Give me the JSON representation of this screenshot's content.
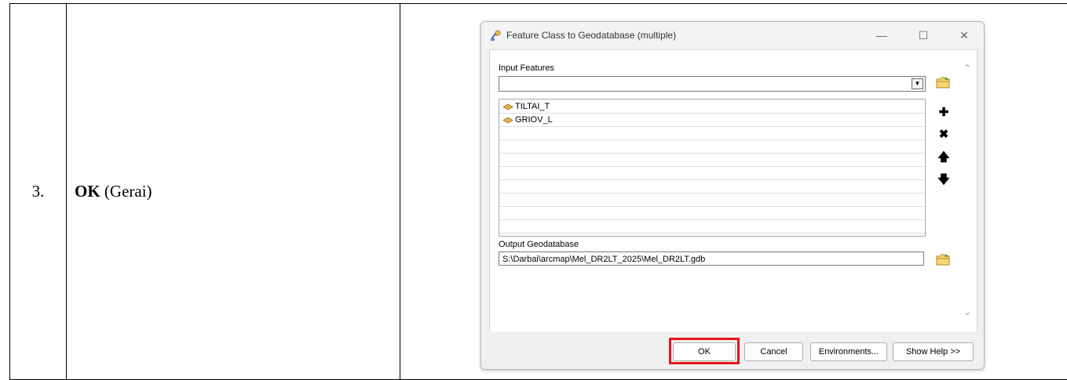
{
  "row": {
    "number": "3.",
    "instruction_bold": "OK",
    "instruction_rest": " (Gerai)"
  },
  "dialog": {
    "title": "Feature Class to Geodatabase (multiple)",
    "input_features_label": "Input Features",
    "input_features_value": "",
    "list_items": [
      "TILTAI_T",
      "GRIOV_L"
    ],
    "output_label": "Output Geodatabase",
    "output_value": "S:\\Darbai\\arcmap\\Mel_DR2LT_2025\\Mel_DR2LT.gdb",
    "buttons": {
      "ok": "OK",
      "cancel": "Cancel",
      "environments": "Environments...",
      "help": "Show Help >>"
    }
  },
  "colors": {
    "highlight": "#e8141c",
    "layer_icon": "#e8b04a"
  }
}
